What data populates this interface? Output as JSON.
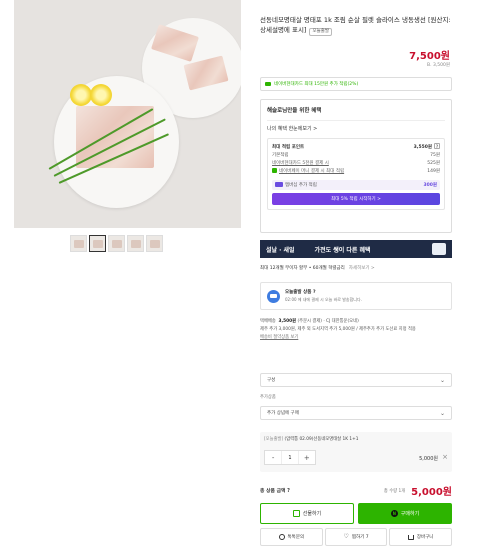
{
  "product": {
    "title": "선동네모명태살 명태포 1k 조림 순살 필렛 슬라이스 냉동생선 [원산지:상세설명에 표시]",
    "origin_badge": "오늘출발",
    "price": "7,500원",
    "shipping_note": "B. 3,500원"
  },
  "card_banner": {
    "text": "네이버현대카드 최대 15만원 추가 적립(2%)",
    "icon": "card-icon"
  },
  "benefits": {
    "title": "해슬로님만을 위한 혜택",
    "sub": "나의 혜택 한눈에보기 >",
    "max_point_label": "최대 적립 포인트",
    "max_point_value": "3,550원",
    "rows": [
      {
        "label": "기본적립",
        "value": "75원"
      },
      {
        "label": "네이버현대카드 5천원 결제 시",
        "value": "525원"
      },
      {
        "label": "네이버페이 머니 결제 시 최대 적립",
        "value": "149원"
      }
    ],
    "membership_label": "멤버십 추가 적립",
    "membership_value": "300원",
    "membership_button": "최대 5% 적립 시작하기 >"
  },
  "promo_banner": {
    "left": "설날 · 새일",
    "main": "가전도 쌩이 다른 혜택"
  },
  "installment": {
    "text": "최대 12개월 무이자 할부 • 60개월 혁렬금리",
    "more": "자세히보기 >"
  },
  "delivery": {
    "title": "오늘출발 상품 ?",
    "desc": "02:00 에 내에 결제 시 오늘 바로 발송합니다."
  },
  "shipping": {
    "label": "택배배송",
    "fee": "3,500원",
    "detail": "(주문시 결제) · CJ 대한통운(오네)",
    "line2": "제주 추가 3,000원, 제주 외 도서지역 추가 5,000원 / 제주추가 추가 도선료 지정 적용",
    "link": "배송비 절약상품 보기"
  },
  "select_composition": {
    "value": "구성"
  },
  "select_extra": {
    "label": "추가상품",
    "value": "추가 상념에 구매"
  },
  "selected_option": {
    "tag": "[오늘출발]",
    "name": "(압력통 02.09)선동네모명태살 1K 1+1",
    "qty": "1",
    "price": "5,000원"
  },
  "total": {
    "label": "총 상품 금액 ?",
    "qty": "총 수량 1개",
    "price": "5,000원"
  },
  "buttons": {
    "gift": "선물하기",
    "buy": "구매하기",
    "talk": "톡톡문의",
    "like": "찜하기 7",
    "cart": "장바구니"
  },
  "colors": {
    "price_red": "#c8102e",
    "naver_green": "#2db400",
    "membership_purple": "#6a4ce0",
    "banner_navy": "#1f2b45"
  }
}
